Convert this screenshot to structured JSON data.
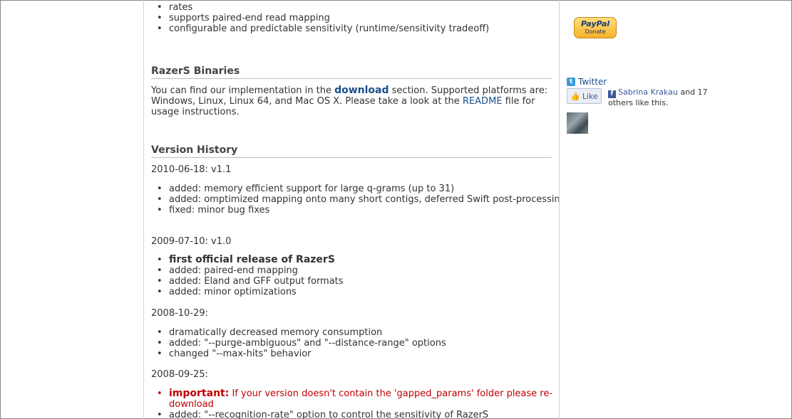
{
  "top_list": [
    "rates",
    "supports paired-end read mapping",
    "configurable and predictable sensitivity (runtime/sensitivity tradeoff)"
  ],
  "binaries": {
    "heading": "RazerS Binaries",
    "text_before": "You can find our implementation in the ",
    "download_link": "download",
    "text_middle": " section. Supported platforms are: Windows, Linux, Linux 64, and Mac OS X. Please take a look at the ",
    "readme_link": "README",
    "text_after": " file for usage instructions."
  },
  "history": {
    "heading": "Version History",
    "v11": {
      "date": "2010-06-18: v1.1",
      "items": [
        "added: memory efficient support for large q-grams (up to 31)",
        "added: omptimized mapping onto many short contigs, deferred Swift post-processing",
        "fixed: minor bug fixes"
      ]
    },
    "v10": {
      "date": "2009-07-10: v1.0",
      "bold_item": "first official release of RazerS",
      "items": [
        "added: paired-end mapping",
        "added: Eland and GFF output formats",
        "added: minor optimizations"
      ]
    },
    "r20081029": {
      "date": "2008-10-29:",
      "items": [
        "dramatically decreased memory consumption",
        "added: \"--purge-ambiguous\" and \"--distance-range\" options",
        "changed \"--max-hits\" behavior"
      ]
    },
    "r20080925": {
      "date": "2008-09-25:",
      "important_label": "important:",
      "important_text": " If your version doesn't contain the 'gapped_params' folder please re-download",
      "items": [
        "added: \"--recognition-rate\" option to control the sensitivity of RazerS"
      ]
    }
  },
  "sidebar": {
    "paypal_brand": "PayPal",
    "paypal_label": "Donate",
    "twitter_label": "Twitter",
    "like_label": "Like",
    "fb_name": "Sabrina Krakau",
    "fb_rest": " and 17 others like this.",
    "colors": {
      "paypal_gold": "#f6b12a",
      "facebook_blue": "#3b5998",
      "link_blue": "#1b4f8a",
      "important_red": "#c00000"
    }
  }
}
